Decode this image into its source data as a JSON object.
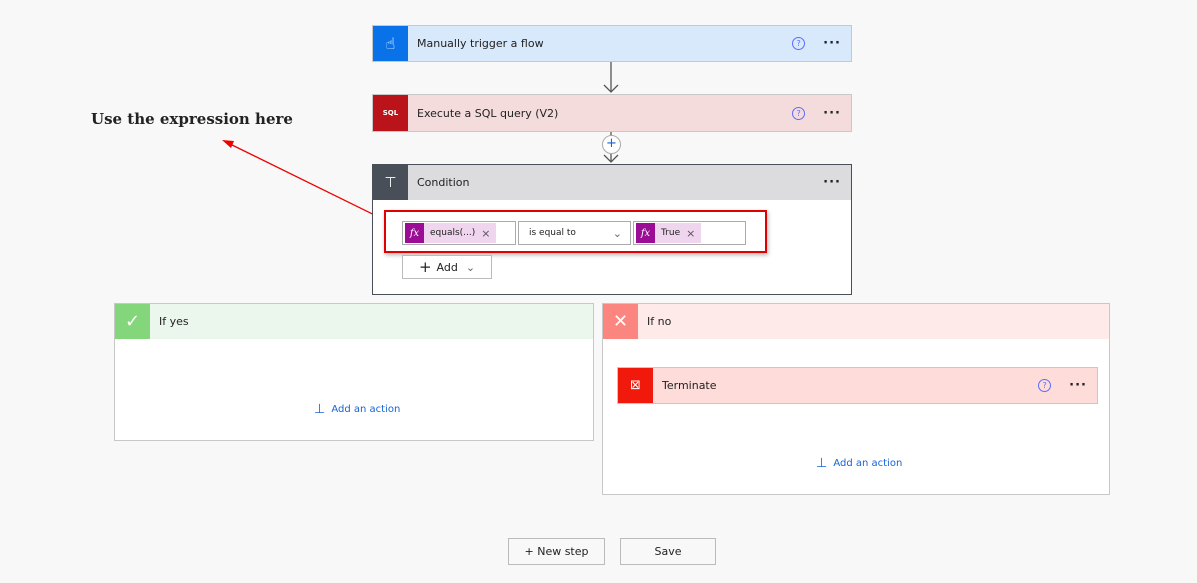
{
  "annotation": "Use the expression here",
  "trigger": {
    "title": "Manually trigger a flow"
  },
  "sql": {
    "title": "Execute a SQL query (V2)"
  },
  "condition": {
    "title": "Condition",
    "left_token": "equals(...)",
    "operator": "is equal to",
    "right_token": "True",
    "add_label": "Add"
  },
  "if_yes": {
    "title": "If yes",
    "add_action": "Add an action"
  },
  "if_no": {
    "title": "If no",
    "terminate": "Terminate",
    "add_action": "Add an action"
  },
  "footer": {
    "new_step": "+ New step",
    "save": "Save"
  },
  "colors": {
    "trigger": "#0a72e8",
    "sql": "#ba141a",
    "condition": "#484f58",
    "yes": "#84d67a",
    "no": "#fb8680",
    "terminate": "#f0190b",
    "highlight": "#e00000"
  }
}
